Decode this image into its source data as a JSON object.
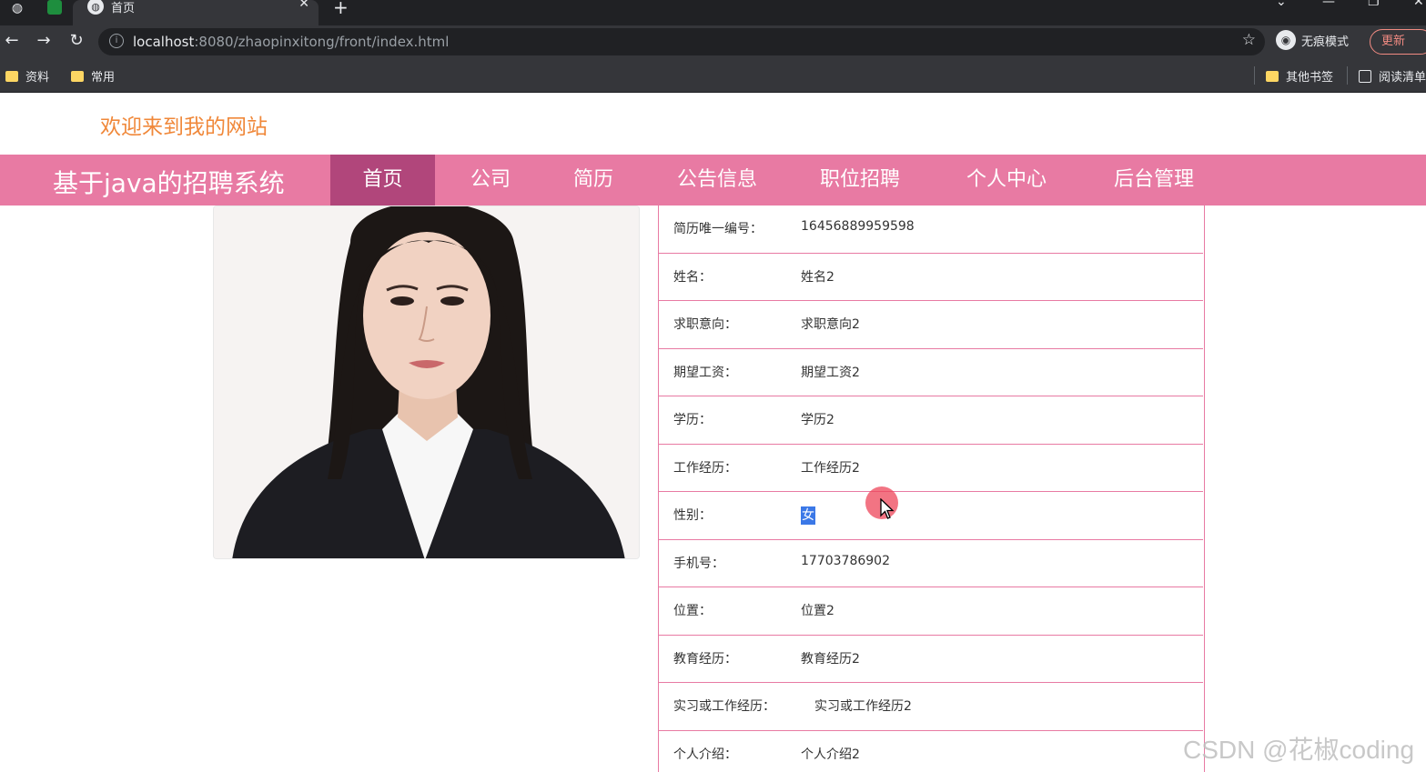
{
  "browser": {
    "tab_title": "首页",
    "url_host": "localhost",
    "url_rest": ":8080/zhaopinxitong/front/index.html",
    "incognito_label": "无痕模式",
    "update_label": "更新",
    "bookmarks": [
      "资料",
      "常用"
    ],
    "bookmarks_right": [
      "其他书签",
      "阅读清单"
    ]
  },
  "site": {
    "welcome": "欢迎来到我的网站",
    "brand": "基于java的招聘系统",
    "nav": [
      "首页",
      "公司",
      "简历",
      "公告信息",
      "职位招聘",
      "个人中心",
      "后台管理"
    ],
    "active_nav": "首页",
    "accent_color": "#e87aa3",
    "active_color": "#b1467b"
  },
  "resume": {
    "rows": [
      {
        "label": "简历唯一编号：",
        "value": "16456889959598"
      },
      {
        "label": "姓名：",
        "value": "姓名2"
      },
      {
        "label": "求职意向：",
        "value": "求职意向2"
      },
      {
        "label": "期望工资：",
        "value": "期望工资2"
      },
      {
        "label": "学历：",
        "value": "学历2"
      },
      {
        "label": "工作经历：",
        "value": "工作经历2"
      },
      {
        "label": "性别：",
        "value": "女"
      },
      {
        "label": "手机号：",
        "value": "17703786902"
      },
      {
        "label": "位置：",
        "value": "位置2"
      },
      {
        "label": "教育经历：",
        "value": "教育经历2"
      },
      {
        "label": "实习或工作经历：",
        "value": "实习或工作经历2"
      },
      {
        "label": "个人介绍：",
        "value": "个人介绍2"
      }
    ]
  },
  "watermark": "CSDN @花椒coding"
}
